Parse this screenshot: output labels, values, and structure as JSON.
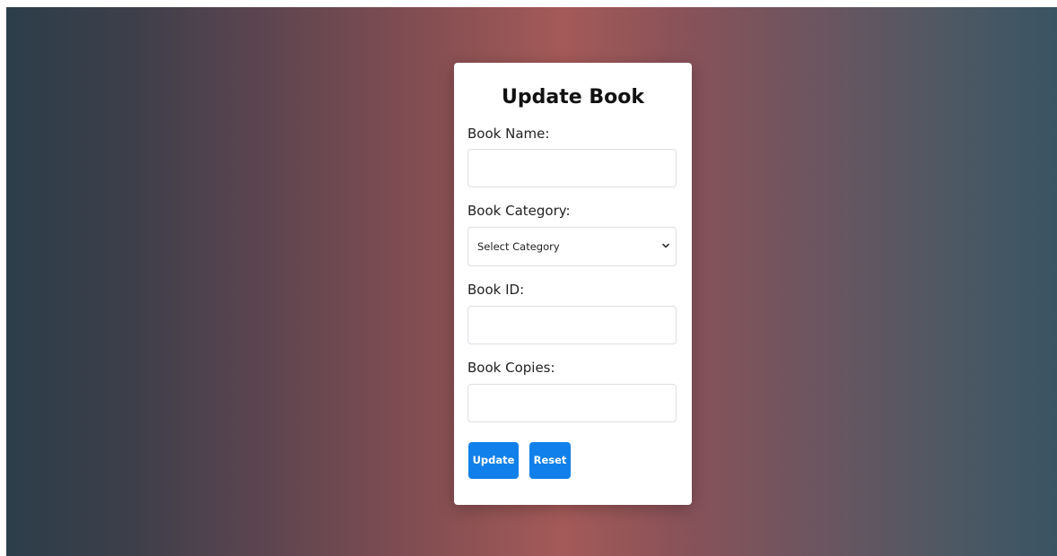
{
  "form": {
    "title": "Update Book",
    "book_name": {
      "label": "Book Name:",
      "value": "",
      "placeholder": ""
    },
    "book_category": {
      "label": "Book Category:",
      "selected": "Select Category"
    },
    "book_id": {
      "label": "Book ID:",
      "value": "",
      "placeholder": ""
    },
    "book_copies": {
      "label": "Book Copies:",
      "value": "",
      "placeholder": ""
    },
    "update_label": "Update",
    "reset_label": "Reset"
  },
  "icons": {
    "select_arrow": "chevron-down-icon"
  },
  "colors": {
    "button": "#1180ea",
    "card": "#ffffff",
    "gradient_edge": "#2c3e4a",
    "gradient_center": "#a45a58"
  }
}
